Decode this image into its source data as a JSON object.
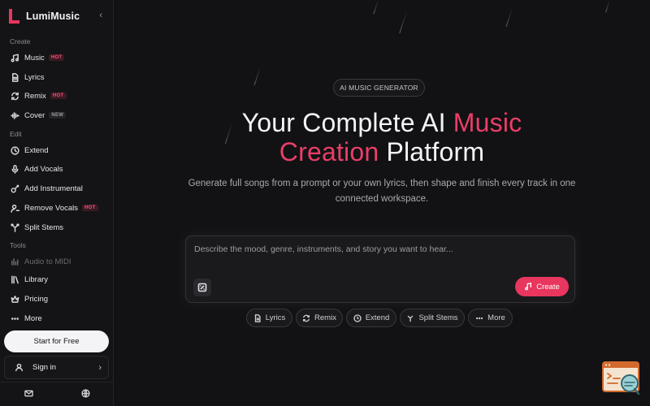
{
  "brand": {
    "name": "LumiMusic",
    "accent": "#e8365e"
  },
  "sidebar": {
    "sections": [
      {
        "label": "Create"
      },
      {
        "label": "Edit"
      },
      {
        "label": "Tools"
      }
    ],
    "items": [
      {
        "label": "Music",
        "icon": "music-note-icon",
        "badge": "HOT"
      },
      {
        "label": "Lyrics",
        "icon": "document-icon"
      },
      {
        "label": "Remix",
        "icon": "refresh-icon",
        "badge": "HOT"
      },
      {
        "label": "Cover",
        "icon": "waveform-icon",
        "badge": "NEW"
      },
      {
        "label": "Extend",
        "icon": "clock-icon"
      },
      {
        "label": "Add Vocals",
        "icon": "microphone-icon"
      },
      {
        "label": "Add Instrumental",
        "icon": "guitar-icon"
      },
      {
        "label": "Remove Vocals",
        "icon": "user-remove-icon",
        "badge": "HOT"
      },
      {
        "label": "Split Stems",
        "icon": "split-icon"
      },
      {
        "label": "Audio to MIDI",
        "icon": "bars-icon"
      },
      {
        "label": "Library",
        "icon": "library-icon"
      },
      {
        "label": "Pricing",
        "icon": "crown-icon"
      },
      {
        "label": "More",
        "icon": "ellipsis-icon"
      }
    ],
    "start_label": "Start for Free",
    "signin_label": "Sign in"
  },
  "main": {
    "tag": "AI MUSIC GENERATOR",
    "hero": {
      "line1_plain": "Your Complete AI ",
      "line1_accent": "Music",
      "line2_accent": "Creation",
      "line2_plain": " Platform"
    },
    "subtitle": "Generate full songs from a prompt or your own lyrics, then shape and finish every track in one connected workspace.",
    "prompt_placeholder": "Describe the mood, genre, instruments, and story you want to hear...",
    "create_label": "Create",
    "chips": [
      "Lyrics",
      "Remix",
      "Extend",
      "Split Stems",
      "More"
    ]
  }
}
